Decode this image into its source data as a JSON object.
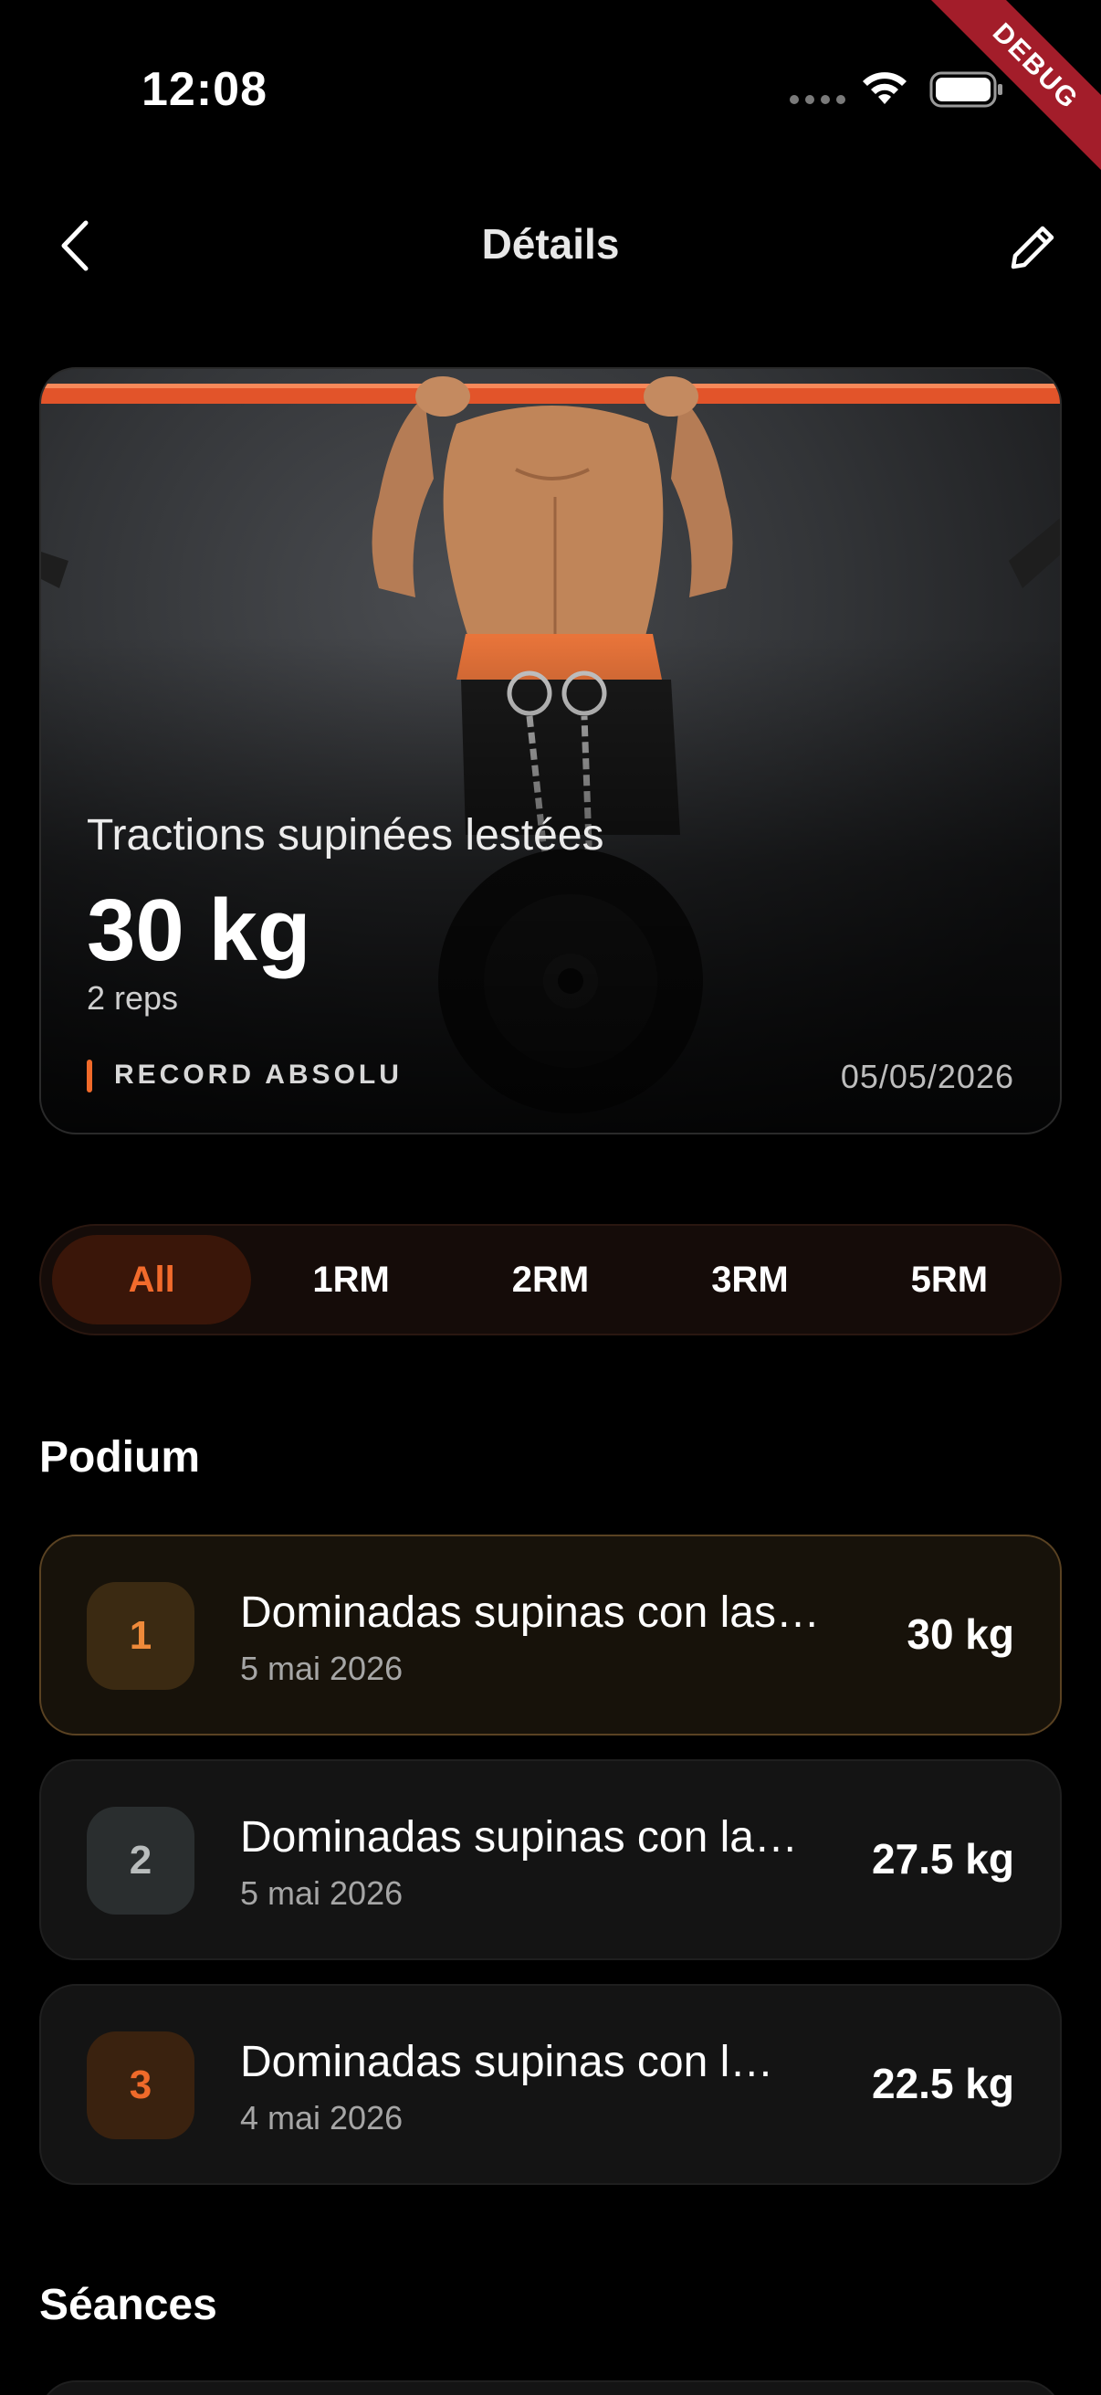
{
  "status_bar": {
    "time": "12:08",
    "debug_label": "DEBUG"
  },
  "app_bar": {
    "title": "Détails"
  },
  "hero": {
    "exercise": "Tractions supinées lestées",
    "weight": "30 kg",
    "reps": "2 reps",
    "badge": "RECORD ABSOLU",
    "date": "05/05/2026"
  },
  "filters": {
    "tabs": [
      {
        "label": "All",
        "active": true
      },
      {
        "label": "1RM",
        "active": false
      },
      {
        "label": "2RM",
        "active": false
      },
      {
        "label": "3RM",
        "active": false
      },
      {
        "label": "5RM",
        "active": false
      }
    ]
  },
  "podium": {
    "title": "Podium",
    "items": [
      {
        "rank": "1",
        "name": "Dominadas supinas con las…",
        "date": "5 mai 2026",
        "value": "30 kg"
      },
      {
        "rank": "2",
        "name": "Dominadas supinas con la…",
        "date": "5 mai 2026",
        "value": "27.5 kg"
      },
      {
        "rank": "3",
        "name": "Dominadas supinas con l…",
        "date": "4 mai 2026",
        "value": "22.5 kg"
      }
    ]
  },
  "sessions": {
    "title": "Séances"
  },
  "colors": {
    "accent": "#f26b2c",
    "gold": "#ef8a3a",
    "silver": "#b9bdbd",
    "bronze": "#ef6a2a"
  }
}
